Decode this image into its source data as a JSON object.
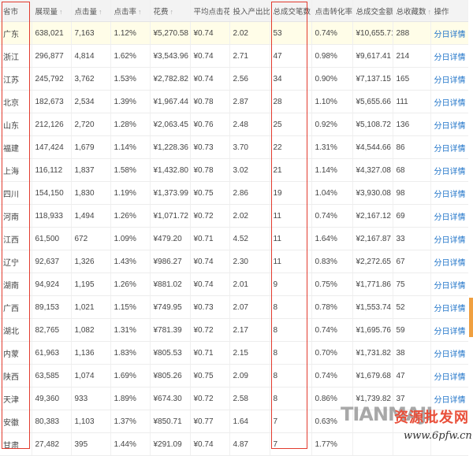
{
  "columns": [
    {
      "label": "省市",
      "sort": "none"
    },
    {
      "label": "展现量",
      "sort": "up"
    },
    {
      "label": "点击量",
      "sort": "up"
    },
    {
      "label": "点击率",
      "sort": "up"
    },
    {
      "label": "花费",
      "sort": "up"
    },
    {
      "label": "平均点击花费",
      "sort": "up"
    },
    {
      "label": "投入产出比",
      "sort": "up"
    },
    {
      "label": "总成交笔数",
      "sort": "down-active"
    },
    {
      "label": "点击转化率",
      "sort": "up"
    },
    {
      "label": "总成交金额",
      "sort": "up"
    },
    {
      "label": "总收藏数",
      "sort": "up"
    },
    {
      "label": "操作",
      "sort": "none"
    }
  ],
  "sort_icons": {
    "up": "↑",
    "down-active": "↓"
  },
  "rows": [
    [
      "广东",
      "638,021",
      "7,163",
      "1.12%",
      "¥5,270.58",
      "¥0.74",
      "2.02",
      "53",
      "0.74%",
      "¥10,655.71",
      "288",
      "分日详情"
    ],
    [
      "浙江",
      "296,877",
      "4,814",
      "1.62%",
      "¥3,543.96",
      "¥0.74",
      "2.71",
      "47",
      "0.98%",
      "¥9,617.41",
      "214",
      "分日详情"
    ],
    [
      "江苏",
      "245,792",
      "3,762",
      "1.53%",
      "¥2,782.82",
      "¥0.74",
      "2.56",
      "34",
      "0.90%",
      "¥7,137.15",
      "165",
      "分日详情"
    ],
    [
      "北京",
      "182,673",
      "2,534",
      "1.39%",
      "¥1,967.44",
      "¥0.78",
      "2.87",
      "28",
      "1.10%",
      "¥5,655.66",
      "111",
      "分日详情"
    ],
    [
      "山东",
      "212,126",
      "2,720",
      "1.28%",
      "¥2,063.45",
      "¥0.76",
      "2.48",
      "25",
      "0.92%",
      "¥5,108.72",
      "136",
      "分日详情"
    ],
    [
      "福建",
      "147,424",
      "1,679",
      "1.14%",
      "¥1,228.36",
      "¥0.73",
      "3.70",
      "22",
      "1.31%",
      "¥4,544.66",
      "86",
      "分日详情"
    ],
    [
      "上海",
      "116,112",
      "1,837",
      "1.58%",
      "¥1,432.80",
      "¥0.78",
      "3.02",
      "21",
      "1.14%",
      "¥4,327.08",
      "68",
      "分日详情"
    ],
    [
      "四川",
      "154,150",
      "1,830",
      "1.19%",
      "¥1,373.99",
      "¥0.75",
      "2.86",
      "19",
      "1.04%",
      "¥3,930.08",
      "98",
      "分日详情"
    ],
    [
      "河南",
      "118,933",
      "1,494",
      "1.26%",
      "¥1,071.72",
      "¥0.72",
      "2.02",
      "11",
      "0.74%",
      "¥2,167.12",
      "69",
      "分日详情"
    ],
    [
      "江西",
      "61,500",
      "672",
      "1.09%",
      "¥479.20",
      "¥0.71",
      "4.52",
      "11",
      "1.64%",
      "¥2,167.87",
      "33",
      "分日详情"
    ],
    [
      "辽宁",
      "92,637",
      "1,326",
      "1.43%",
      "¥986.27",
      "¥0.74",
      "2.30",
      "11",
      "0.83%",
      "¥2,272.65",
      "67",
      "分日详情"
    ],
    [
      "湖南",
      "94,924",
      "1,195",
      "1.26%",
      "¥881.02",
      "¥0.74",
      "2.01",
      "9",
      "0.75%",
      "¥1,771.86",
      "75",
      "分日详情"
    ],
    [
      "广西",
      "89,153",
      "1,021",
      "1.15%",
      "¥749.95",
      "¥0.73",
      "2.07",
      "8",
      "0.78%",
      "¥1,553.74",
      "52",
      "分日详情"
    ],
    [
      "湖北",
      "82,765",
      "1,082",
      "1.31%",
      "¥781.39",
      "¥0.72",
      "2.17",
      "8",
      "0.74%",
      "¥1,695.76",
      "59",
      "分日详情"
    ],
    [
      "内蒙",
      "61,963",
      "1,136",
      "1.83%",
      "¥805.53",
      "¥0.71",
      "2.15",
      "8",
      "0.70%",
      "¥1,731.82",
      "38",
      "分日详情"
    ],
    [
      "陕西",
      "63,585",
      "1,074",
      "1.69%",
      "¥805.26",
      "¥0.75",
      "2.09",
      "8",
      "0.74%",
      "¥1,679.68",
      "47",
      "分日详情"
    ],
    [
      "天津",
      "49,360",
      "933",
      "1.89%",
      "¥674.30",
      "¥0.72",
      "2.58",
      "8",
      "0.86%",
      "¥1,739.82",
      "37",
      "分日详情"
    ],
    [
      "安徽",
      "80,383",
      "1,103",
      "1.37%",
      "¥850.71",
      "¥0.77",
      "1.64",
      "7",
      "0.63%",
      "",
      "",
      " "
    ],
    [
      "甘肃",
      "27,482",
      "395",
      "1.44%",
      "¥291.09",
      "¥0.74",
      "4.87",
      "7",
      "1.77%",
      "",
      "",
      " "
    ]
  ],
  "watermark": {
    "latin": "TIANMAJI",
    "cn": "资源批发网",
    "url": "www.6pfw.cn"
  }
}
